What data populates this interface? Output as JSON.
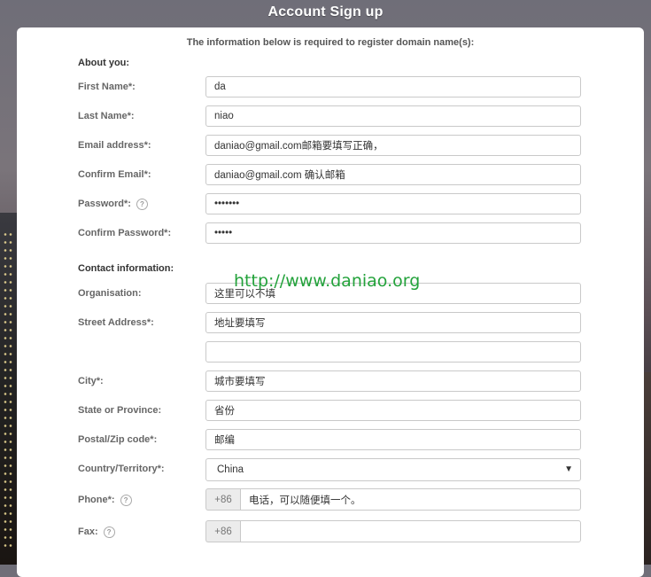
{
  "window": {
    "title": "Account Sign up"
  },
  "intro": "The information below is required to register domain name(s):",
  "sections": {
    "about": "About you:",
    "contact": "Contact information:"
  },
  "fields": {
    "first_name": {
      "label": "First Name*:",
      "value": "da"
    },
    "last_name": {
      "label": "Last Name*:",
      "value": "niao"
    },
    "email": {
      "label": "Email address*:",
      "value": "daniao@gmail.com邮箱要填写正确，"
    },
    "confirm_email": {
      "label": "Confirm Email*:",
      "value": "daniao@gmail.com 确认邮箱"
    },
    "password": {
      "label": "Password*:",
      "value": "•••••••"
    },
    "confirm_password": {
      "label": "Confirm Password*:",
      "value": "•••••"
    },
    "organisation": {
      "label": "Organisation:",
      "value": "这里可以不填"
    },
    "street": {
      "label": "Street Address*:",
      "value": "地址要填写",
      "value2": ""
    },
    "city": {
      "label": "City*:",
      "value": "城市要填写"
    },
    "state": {
      "label": "State or Province:",
      "value": "省份"
    },
    "postal": {
      "label": "Postal/Zip code*:",
      "value": "邮编"
    },
    "country": {
      "label": "Country/Territory*:",
      "value": "China"
    },
    "phone": {
      "label": "Phone*:",
      "prefix": "+86",
      "value": "电话，可以随便填一个。"
    },
    "fax": {
      "label": "Fax:",
      "prefix": "+86",
      "value": ""
    }
  },
  "help_glyph": "?",
  "select_arrow": "▼",
  "watermark": "http://www.daniao.org",
  "icons": {
    "help": "question-circle-icon",
    "dropdown": "triangle-down-icon"
  }
}
